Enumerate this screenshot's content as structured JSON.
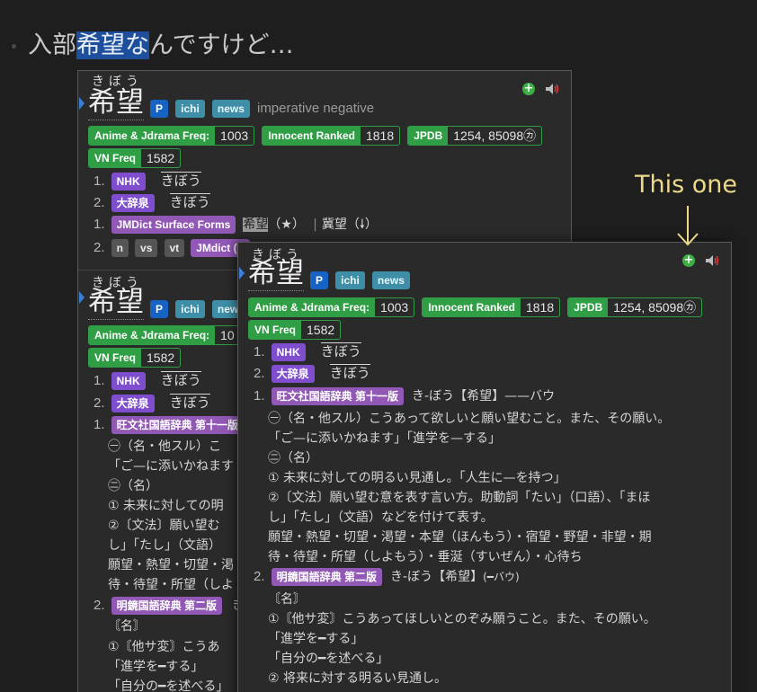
{
  "sentence": {
    "pre": "入部",
    "highlight": "希望な",
    "post": "んですけど…"
  },
  "annotation": "This one",
  "colors": {
    "accent_blue": "#1763c4",
    "freq_green": "#2f9e45",
    "dict_purple": "#9158b6",
    "annotation_yellow": "#ecd98a"
  },
  "icons": {
    "add": "plus-circle-icon",
    "audio": "speaker-icon",
    "arrow": "arrow-down-icon"
  },
  "back_popup": {
    "entry1": {
      "reading": "きぼう",
      "headword": "希望",
      "tags": [
        "P",
        "ichi",
        "news"
      ],
      "inflection": "imperative negative",
      "freq": [
        {
          "key": "Anime & Jdrama Freq:",
          "value": "1003"
        },
        {
          "key": "Innocent Ranked",
          "value": "1818"
        },
        {
          "key": "JPDB",
          "value": "1254, 85098㋕"
        },
        {
          "key": "VN Freq",
          "value": "1582"
        }
      ],
      "pitch": [
        {
          "num": "1.",
          "dict": "NHK",
          "reading": "きぼう"
        },
        {
          "num": "2.",
          "dict": "大辞泉",
          "reading": "きぼう"
        }
      ],
      "forms": {
        "num": "1.",
        "dict": "JMDict Surface Forms",
        "form1": "希望",
        "mark1": "（★）",
        "sep": "|",
        "form2": "冀望",
        "mark2": "（🠗）"
      },
      "def2": {
        "num": "2.",
        "tags": [
          "n",
          "vs",
          "vt"
        ],
        "dict": "JMdict (E"
      }
    },
    "entry2": {
      "reading": "きぼう",
      "headword": "希望",
      "tags": [
        "P",
        "ichi",
        "news"
      ],
      "freq": [
        {
          "key": "Anime & Jdrama Freq:",
          "value": "10"
        },
        {
          "key": "VN Freq",
          "value": "1582"
        }
      ],
      "pitch": [
        {
          "num": "1.",
          "dict": "NHK",
          "reading": "きぼう"
        },
        {
          "num": "2.",
          "dict": "大辞泉",
          "reading": "きぼう"
        }
      ],
      "def1": {
        "num": "1.",
        "dict": "旺文社国語辞典 第十一版",
        "lines": [
          "㊀（名・他スル）こ",
          "「ご—に添いかねます",
          "㊁（名）",
          "① 未来に対しての明",
          "②〔文法〕願い望む",
          "し」「たし」（文語）",
          "願望・熱望・切望・渇",
          "待・待望・所望（しよ"
        ]
      },
      "def2": {
        "num": "2.",
        "dict": "明鏡国語辞典 第二版",
        "head": "き",
        "lines": [
          "〘名〙",
          "①〘他サ変〙こうあ",
          "「進学を━する」",
          "「自分の━を述べる」"
        ]
      }
    }
  },
  "front_popup": {
    "reading": "きぼう",
    "headword": "希望",
    "tags": [
      "P",
      "ichi",
      "news"
    ],
    "freq": [
      {
        "key": "Anime & Jdrama Freq:",
        "value": "1003"
      },
      {
        "key": "Innocent Ranked",
        "value": "1818"
      },
      {
        "key": "JPDB",
        "value": "1254, 85098㋕"
      },
      {
        "key": "VN Freq",
        "value": "1582"
      }
    ],
    "pitch": [
      {
        "num": "1.",
        "dict": "NHK",
        "reading": "きぼう"
      },
      {
        "num": "2.",
        "dict": "大辞泉",
        "reading": "きぼう"
      }
    ],
    "def1": {
      "num": "1.",
      "dict": "旺文社国語辞典 第十一版",
      "head": "き-ぼう【希望】——バウ",
      "lines": [
        "㊀（名・他スル）こうあって欲しいと願い望むこと。また、その願い。",
        "「ご—に添いかねます」「進学を—する」",
        "㊁（名）",
        "① 未来に対しての明るい見通し。「人生に—を持つ」",
        "②〔文法〕願い望む意を表す言い方。助動詞「たい」（口語）、「まほ",
        "し」「たし」（文語）などを付けて表す。",
        "願望・熱望・切望・渇望・本望（ほんもう）・宿望・野望・非望・期",
        "待・待望・所望（しよもう）・垂涎（すいぜん）・心待ち"
      ]
    },
    "def2": {
      "num": "2.",
      "dict": "明鏡国語辞典 第二版",
      "head": "き-ぼう【希望】",
      "head_small": "(━バウ)",
      "lines": [
        "〘名〙",
        "①〘他サ変〙こうあってほしいとのぞみ願うこと。また、その願い。",
        "「進学を━する」",
        "「自分の━を述べる」",
        "② 将来に対する明るい見通し。"
      ]
    }
  }
}
